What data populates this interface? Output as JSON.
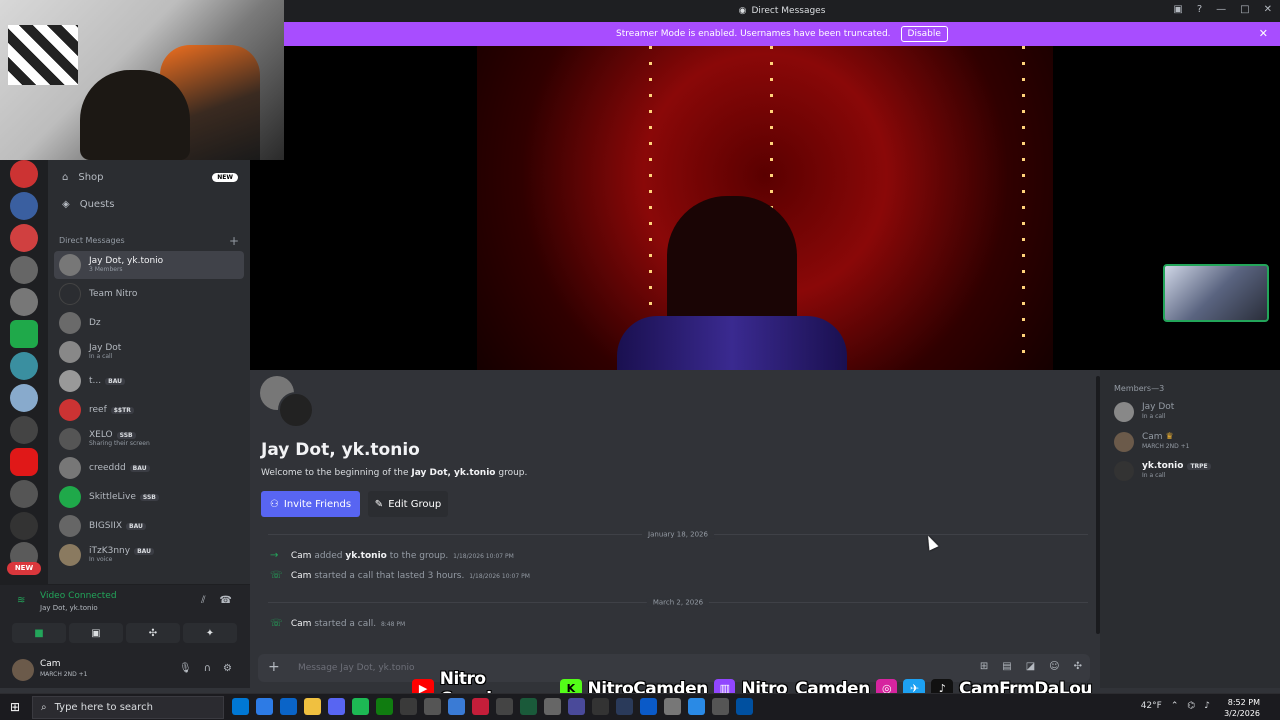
{
  "window": {
    "title": "Direct Messages"
  },
  "banner": {
    "text": "Streamer Mode is enabled. Usernames have been truncated.",
    "disable_label": "Disable"
  },
  "sidebar": {
    "nav": [
      {
        "label": "Shop",
        "badge": "NEW"
      },
      {
        "label": "Quests"
      }
    ],
    "dm_header": "Direct Messages",
    "dms": [
      {
        "name": "Jay Dot, yk.tonio",
        "sub": "3 Members",
        "selected": true
      },
      {
        "name": "Team Nitro"
      },
      {
        "name": "Dz"
      },
      {
        "name": "Jay Dot",
        "sub": "In a call"
      },
      {
        "name": "t...",
        "tag": "BAU"
      },
      {
        "name": "reef",
        "tag": "$$TR"
      },
      {
        "name": "XELO",
        "tag": "SSB",
        "sub": "Sharing their screen"
      },
      {
        "name": "creeddd",
        "tag": "BAU"
      },
      {
        "name": "SkittleLive",
        "tag": "SSB"
      },
      {
        "name": "BIGSIIX",
        "tag": "BAU"
      },
      {
        "name": "iTzK3nny",
        "tag": "BAU",
        "sub": "In voice"
      }
    ],
    "server_new_badge": "NEW"
  },
  "voice": {
    "status": "Video Connected",
    "channel": "Jay Dot, yk.tonio"
  },
  "user": {
    "name": "Cam",
    "status": "MARCH 2ND +1"
  },
  "chat": {
    "group_title": "Jay Dot, yk.tonio",
    "welcome_prefix": "Welcome to the beginning of the",
    "welcome_group": "Jay Dot, yk.tonio",
    "welcome_suffix": "group.",
    "invite_label": "Invite Friends",
    "edit_label": "Edit Group",
    "date1": "January 18, 2026",
    "msg1_user": "Cam",
    "msg1_action": "added",
    "msg1_target": "yk.tonio",
    "msg1_suffix": "to the group.",
    "msg1_time": "1/18/2026 10:07 PM",
    "msg2_user": "Cam",
    "msg2_text": "started a call that lasted 3 hours.",
    "msg2_time": "1/18/2026 10:07 PM",
    "date2": "March 2, 2026",
    "msg3_user": "Cam",
    "msg3_text": "started a call.",
    "msg3_time": "8:48 PM",
    "composer_placeholder": "Message Jay Dot, yk.tonio"
  },
  "members": {
    "header": "Members—3",
    "list": [
      {
        "name": "Jay Dot",
        "sub": "In a call"
      },
      {
        "name": "Cam",
        "sub": "MARCH 2ND +1"
      },
      {
        "name": "yk.tonio",
        "tag": "TRPE",
        "sub": "In a call"
      }
    ]
  },
  "social": {
    "youtube": "Nitro Camden",
    "kick": "NitroCamden",
    "twitch": "Nitro_Camden",
    "other": "CamFrmDaLou"
  },
  "taskbar": {
    "search_placeholder": "Type here to search",
    "weather": "42°F",
    "time": "8:52 PM",
    "date": "3/2/2026"
  },
  "colors": {
    "banner": "#a84dff",
    "brand": "#5865f2",
    "online": "#23a55a"
  }
}
